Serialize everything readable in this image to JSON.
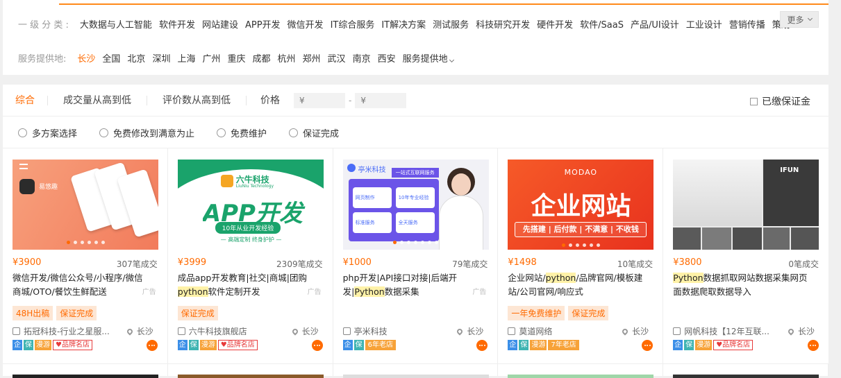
{
  "filters": {
    "category_label": "一 级 分 类 :",
    "categories": [
      "大数据与人工智能",
      "软件开发",
      "网站建设",
      "APP开发",
      "微信开发",
      "IT综合服务",
      "IT解决方案",
      "测试服务",
      "科技研究开发",
      "硬件开发",
      "软件/SaaS",
      "产品/UI设计",
      "工业设计",
      "营销传播",
      "策划"
    ],
    "more_label": "更多",
    "location_label": "服务提供地:",
    "locations": [
      "长沙",
      "全国",
      "北京",
      "深圳",
      "上海",
      "广州",
      "重庆",
      "成都",
      "杭州",
      "郑州",
      "武汉",
      "南京",
      "西安"
    ],
    "location_more": "服务提供地",
    "active_location": "长沙"
  },
  "sort": {
    "items": [
      "综合",
      "成交量从高到低",
      "评价数从高到低",
      "价格"
    ],
    "price_from_placeholder": "¥",
    "price_to_placeholder": "¥",
    "price_dash": "-",
    "deposit_label": "已缴保证金"
  },
  "options": [
    "多方案选择",
    "免费修改到满意为止",
    "免费维护",
    "保证完成"
  ],
  "cards": [
    {
      "price": "¥3900",
      "deals": "307笔成交",
      "title_parts": [
        [
          "微信开发/微信公众号/小程序/微信商城/OTO/餐饮生鲜配送",
          false
        ]
      ],
      "ad": "广告",
      "tags": [
        "48H出稿",
        "保证完成"
      ],
      "shop": "拓冠科技-行业之星服...",
      "loc": "长沙",
      "badges": {
        "qi": "企",
        "bao": "保",
        "man": "漫游",
        "brand": "♥品牌名店"
      }
    },
    {
      "price": "¥3999",
      "deals": "2309笔成交",
      "title_parts": [
        [
          "成品app开发教育|社交|商城|团购",
          false
        ],
        [
          "python",
          true
        ],
        [
          "软件定制开发",
          false
        ]
      ],
      "ad": "广告",
      "tags": [
        "保证完成"
      ],
      "shop": "六牛科技旗舰店",
      "loc": "长沙",
      "badges": {
        "qi": "企",
        "bao": "保",
        "man": "漫游",
        "brand": "♥品牌名店"
      }
    },
    {
      "price": "¥1000",
      "deals": "79笔成交",
      "title_parts": [
        [
          "php开发|API接口对接|后端开发|",
          false
        ],
        [
          "Python",
          true
        ],
        [
          "数据采集",
          false
        ]
      ],
      "ad": "广告",
      "tags": [],
      "shop": "亭米科技",
      "loc": "长沙",
      "badges": {
        "qi": "企",
        "bao": "保",
        "year": "6年老店"
      }
    },
    {
      "price": "¥1498",
      "deals": "10笔成交",
      "title_parts": [
        [
          "企业网站/",
          false
        ],
        [
          "python",
          true
        ],
        [
          "/品牌官网/模板建站/公司官网/响应式",
          false
        ]
      ],
      "ad": "",
      "tags": [
        "一年免费维护",
        "保证完成"
      ],
      "shop": "莫道网络",
      "loc": "长沙",
      "badges": {
        "qi": "企",
        "bao": "保",
        "man": "漫游",
        "year": "7年老店"
      }
    },
    {
      "price": "¥3800",
      "deals": "0笔成交",
      "title_parts": [
        [
          "Python",
          true
        ],
        [
          "数据抓取网站数据采集网页面数据爬取数据导入",
          false
        ]
      ],
      "ad": "",
      "tags": [],
      "shop": "网帆科技【12年互联...",
      "loc": "长沙",
      "badges": {
        "qi": "企",
        "bao": "保",
        "man": "漫游",
        "brand": "♥品牌名店"
      }
    }
  ],
  "thumbs": {
    "card1_app_name": "易悠趣",
    "card2_brand": "六牛科技",
    "card2_brand_en": "LiuNiu Technology",
    "card2_big": "APP开发",
    "card2_sub": "10年从业开发经验",
    "card2_slogan": "— 高端定制  终身护护 —",
    "card3_brand": "亭米科技",
    "card3_banner": "一站式互联网服务",
    "card3_items": [
      "网页制作",
      "10年专业经验",
      "标准服务",
      "全天服务"
    ],
    "card4_logo": "MODAO",
    "card4_big": "企业网站",
    "card4_sub": "先搭建 | 后付款 | 不满意 | 不收钱",
    "card5_logo": "IFUN"
  },
  "colors": {
    "accent": "#ff6a00",
    "hl": "#fff2a8"
  }
}
